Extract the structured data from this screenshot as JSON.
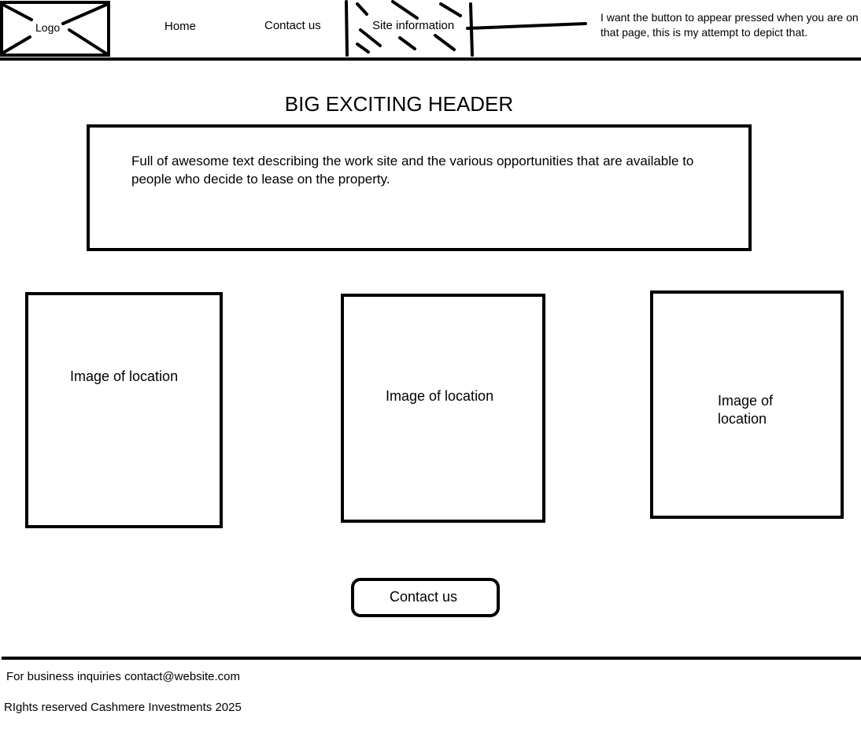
{
  "nav": {
    "logo_label": "Logo",
    "items": [
      {
        "label": "Home"
      },
      {
        "label": "Contact us"
      },
      {
        "label": "Site information"
      }
    ],
    "annotation": "I want the button to appear pressed when you are on that page, this is my attempt to depict that."
  },
  "main": {
    "header": "BIG EXCITING HEADER",
    "description": "Full of awesome text describing the work site and the various opportunities that are available to people who decide to lease on the property.",
    "images": [
      {
        "label": "Image of location"
      },
      {
        "label": "Image of location"
      },
      {
        "label": "Image of location"
      }
    ],
    "contact_button": "Contact us"
  },
  "footer": {
    "inquiries": "For business inquiries contact@website.com",
    "rights": "RIghts reserved Cashmere Investments 2025"
  }
}
